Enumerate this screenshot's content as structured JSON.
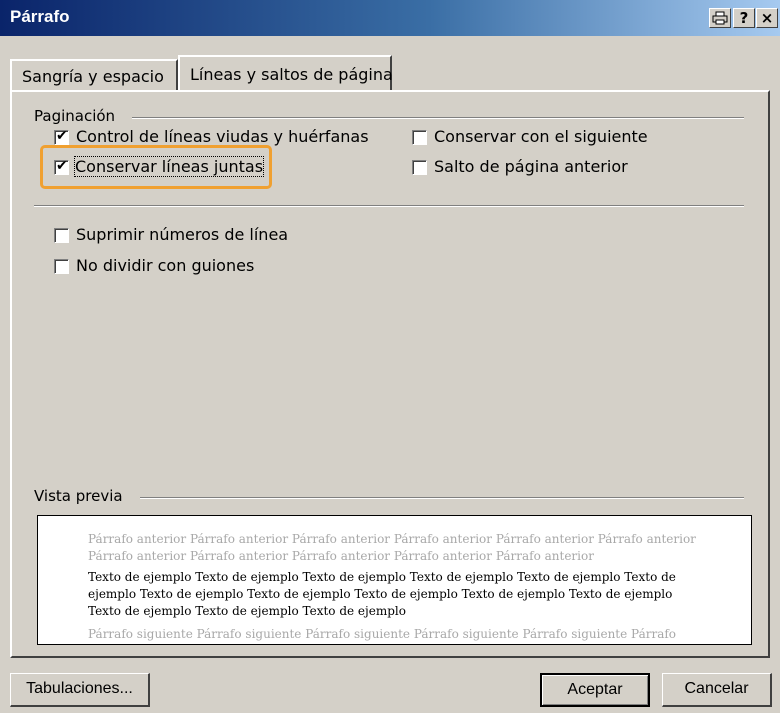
{
  "window": {
    "title": "Párrafo",
    "controls": {
      "print_icon": "printer-icon",
      "help": "?",
      "close": "×"
    }
  },
  "tabs": [
    {
      "label": "Sangría y espacio",
      "active": false
    },
    {
      "label": "Líneas y saltos de página",
      "active": true
    }
  ],
  "pagination": {
    "label": "Paginación",
    "checkboxes": [
      {
        "label": "Control de líneas viudas y huérfanas",
        "checked": true
      },
      {
        "label": "Conservar líneas juntas",
        "checked": true,
        "highlighted": true
      },
      {
        "label": "Conservar con el siguiente",
        "checked": false
      },
      {
        "label": "Salto de página anterior",
        "checked": false
      }
    ]
  },
  "other_options": [
    {
      "label": "Suprimir números de línea",
      "checked": false
    },
    {
      "label": "No dividir con guiones",
      "checked": false
    }
  ],
  "preview": {
    "label": "Vista previa",
    "previous_text": "Párrafo anterior Párrafo anterior Párrafo anterior Párrafo anterior Párrafo anterior Párrafo anterior Párrafo anterior Párrafo anterior Párrafo anterior Párrafo anterior Párrafo anterior",
    "sample_text": "Texto de ejemplo Texto de ejemplo Texto de ejemplo Texto de ejemplo Texto de ejemplo Texto de ejemplo Texto de ejemplo Texto de ejemplo Texto de ejemplo Texto de ejemplo Texto de ejemplo Texto de ejemplo Texto de ejemplo Texto de ejemplo",
    "next_text": "Párrafo siguiente Párrafo siguiente Párrafo siguiente Párrafo siguiente Párrafo siguiente Párrafo"
  },
  "buttons": {
    "tabs": "Tabulaciones...",
    "ok": "Aceptar",
    "cancel": "Cancelar"
  },
  "colors": {
    "title_bar": "#0a246a",
    "highlight": "#f0a030",
    "face": "#d4d0c8"
  }
}
